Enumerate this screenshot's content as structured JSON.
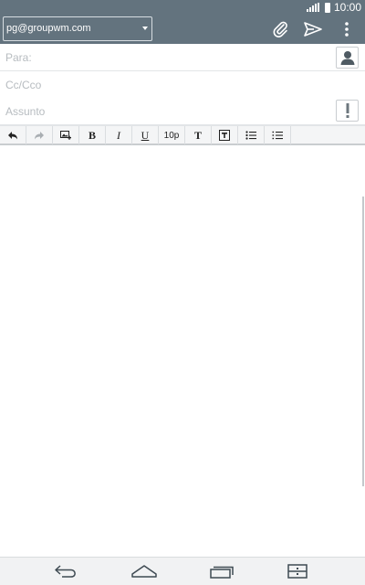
{
  "status_bar": {
    "time": "10:00",
    "icons": [
      "signal-icon",
      "battery-icon"
    ]
  },
  "action_bar": {
    "account": "pg@groupwm.com",
    "icons": [
      "attach-icon",
      "send-icon",
      "more-options-icon"
    ]
  },
  "fields": {
    "to_placeholder": "Para:",
    "cc_placeholder": "Cc/Cco",
    "subject_placeholder": "Assunto",
    "to_value": "",
    "cc_value": "",
    "subject_value": ""
  },
  "toolbar": {
    "undo_icon": "undo-icon",
    "redo_icon": "redo-icon",
    "insert_image_icon": "insert-image-icon",
    "bold_label": "B",
    "italic_label": "I",
    "underline_label": "U",
    "font_size_label": "10p",
    "text_color_label": "T",
    "text_bg_icon": "text-background-icon",
    "bullet_list_icon": "bullet-list-icon",
    "numbered_list_icon": "numbered-list-icon"
  },
  "navigation": {
    "icons": [
      "back-icon",
      "home-icon",
      "recent-apps-icon",
      "dual-window-icon"
    ]
  },
  "colors": {
    "action_bar": "#63737e",
    "toolbar_bg": "#f4f5f6",
    "nav_bg": "#f1f2f3"
  }
}
